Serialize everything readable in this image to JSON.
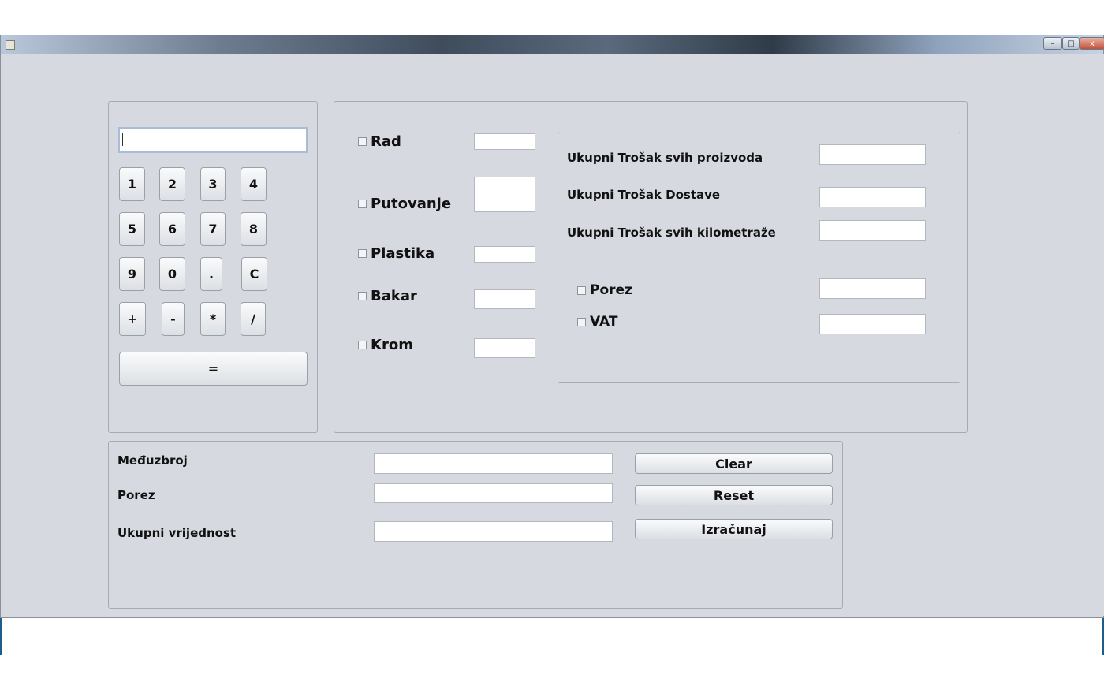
{
  "window": {
    "title": ""
  },
  "titlebar_buttons": {
    "minimize": "–",
    "maximize": "□",
    "close": "x"
  },
  "calculator": {
    "display_value": "",
    "keys": [
      "1",
      "2",
      "3",
      "4",
      "5",
      "6",
      "7",
      "8",
      "9",
      "0",
      ".",
      "C",
      "+",
      "-",
      "*",
      "/"
    ],
    "equals": "="
  },
  "items": {
    "rad": "Rad",
    "putovanje": "Putovanje",
    "plastika": "Plastika",
    "bakar": "Bakar",
    "krom": "Krom"
  },
  "totals": {
    "proizvoda": "Ukupni Trošak svih  proizvoda",
    "dostave": "Ukupni Trošak Dostave",
    "kilometraze": "Ukupni Trošak svih  kilometraže",
    "porez": "Porez",
    "vat": "VAT"
  },
  "summary": {
    "meduzbroj": "Međuzbroj",
    "porez": "Porez",
    "ukupni": "Ukupni vrijednost"
  },
  "actions": {
    "clear": "Clear",
    "reset": "Reset",
    "izracunaj": "Izračunaj"
  }
}
